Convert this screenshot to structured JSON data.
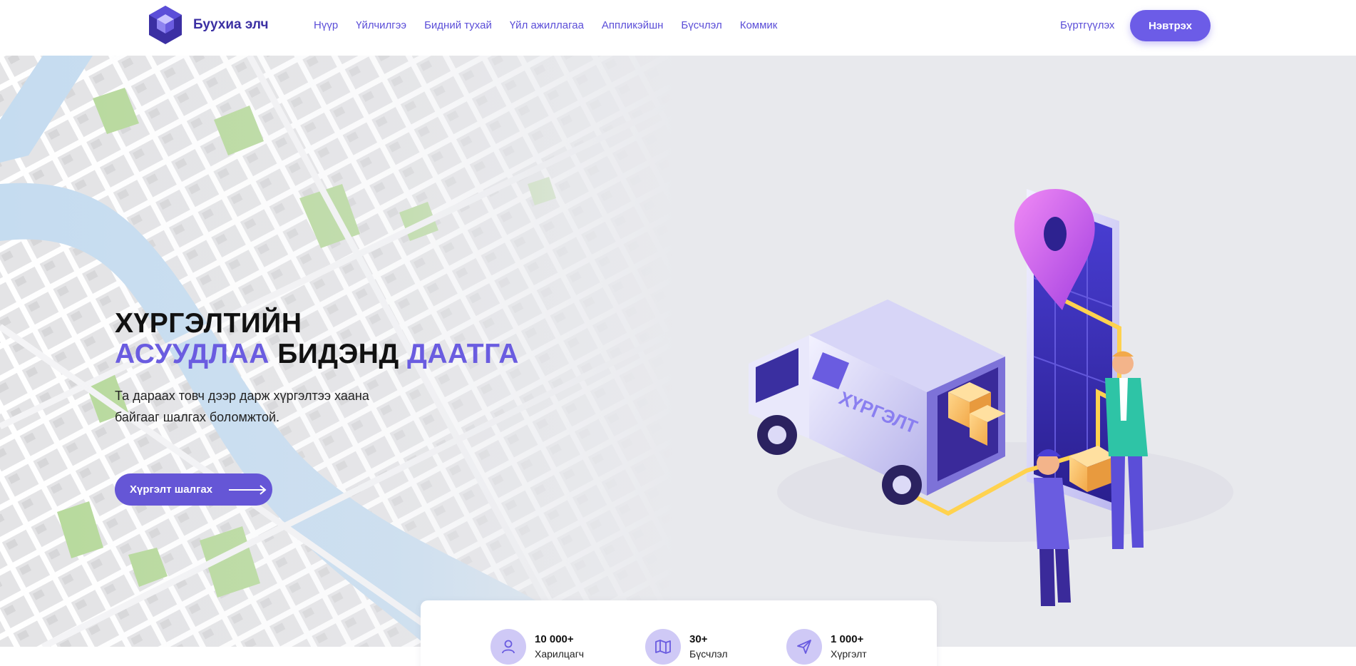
{
  "brand": {
    "name": "Буухиа элч"
  },
  "nav": {
    "items": [
      {
        "label": "Нүүр"
      },
      {
        "label": "Үйлчилгээ"
      },
      {
        "label": "Бидний тухай"
      },
      {
        "label": "Үйл ажиллагаа"
      },
      {
        "label": "Аппликэйшн"
      },
      {
        "label": "Бүсчлэл"
      },
      {
        "label": "Коммик"
      }
    ],
    "register_label": "Бүртгүүлэх",
    "login_label": "Нэвтрэх"
  },
  "hero": {
    "title_line1": "ХҮРГЭЛТИЙН",
    "title_word1": "АСУУДЛАА",
    "title_word2": "БИДЭНД",
    "title_word3": "ДААТГА",
    "description": "Та дараах товч дээр дарж хүргэлтээ хаана байгааг шалгах боломжтой.",
    "cta_label": "Хүргэлт шалгах",
    "truck_text": "ХҮРГЭЛТ"
  },
  "stats": [
    {
      "value": "10 000+",
      "label": "Харилцагч",
      "icon": "user-icon"
    },
    {
      "value": "30+",
      "label": "Бүсчлэл",
      "icon": "map-icon"
    },
    {
      "value": "1 000+",
      "label": "Хүргэлт",
      "icon": "send-icon"
    }
  ],
  "colors": {
    "accent": "#6c5ce7",
    "brand_text": "#3b2fa3",
    "hero_bg": "#e8e9ed",
    "stat_icon_bg": "#cfc9f6"
  }
}
